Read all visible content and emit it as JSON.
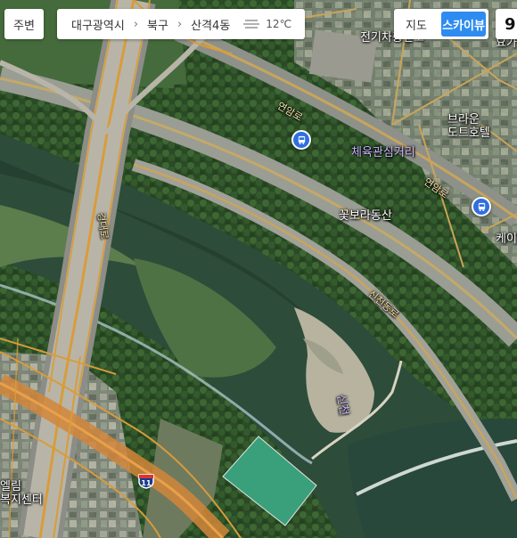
{
  "toolbar": {
    "nearby_label": "주변",
    "breadcrumb": [
      "대구광역시",
      "북구",
      "산격4동"
    ],
    "temperature": "12℃",
    "weather_icon": "haze-icon",
    "map_label": "지도",
    "skyview_label": "스카이뷰",
    "active_view": "스카이뷰",
    "extra_label": "9"
  },
  "map": {
    "labels": {
      "ev_station": "전기차충전소",
      "hotel": "브라운\n도트호텔",
      "sports_street": "체육관심거리",
      "flower_mountain": "꽃보라동산",
      "road_yeonam": "연암로",
      "road_yeonam2": "연암로",
      "road_sinchen": "신천동로",
      "road_gyeongdaero": "경대로",
      "sincheon": "신천",
      "welfare_center": "엘림\n복지센터",
      "cafe": "케이",
      "top_right": "요가"
    },
    "route_number": "11",
    "colors": {
      "accent": "#2e8cf0",
      "road": "#d79a3a",
      "bus_stop": "#2f6fe0"
    }
  }
}
